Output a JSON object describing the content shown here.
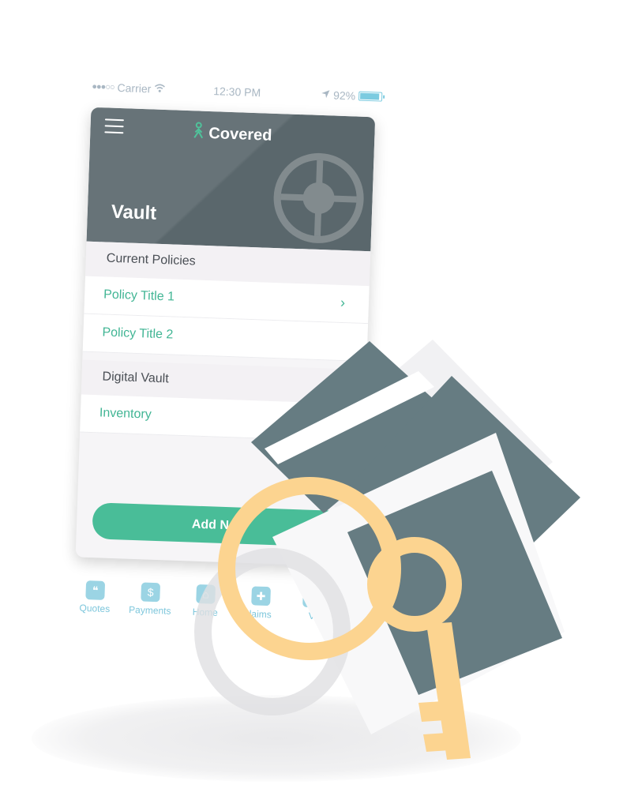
{
  "status_bar": {
    "carrier": "Carrier",
    "time": "12:30 PM",
    "battery": "92%"
  },
  "header": {
    "brand": "Covered",
    "title": "Vault"
  },
  "sections": {
    "current_policies": {
      "label": "Current Policies",
      "items": [
        "Policy Title 1",
        "Policy Title 2"
      ]
    },
    "digital_vault": {
      "label": "Digital Vault",
      "items": [
        "Inventory"
      ]
    }
  },
  "add_button_label": "Add New",
  "tabs": [
    {
      "label": "Quotes",
      "icon": "quote-bubble-icon"
    },
    {
      "label": "Payments",
      "icon": "payments-icon"
    },
    {
      "label": "Home",
      "icon": "home-icon"
    },
    {
      "label": "laims",
      "icon": "claims-bandage-icon"
    },
    {
      "label": "V",
      "icon": "vault-icon"
    }
  ],
  "colors": {
    "header": "#5a676c",
    "accent": "#49bd98",
    "tab": "#7fc7dc",
    "key": "#fcd490",
    "document": "#667c82"
  }
}
